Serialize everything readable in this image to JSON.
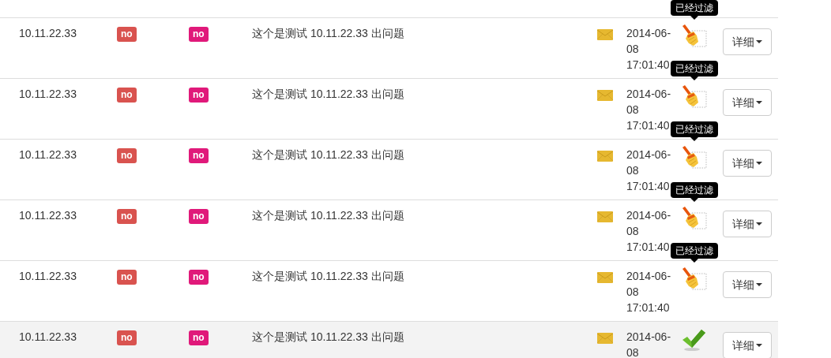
{
  "rows": [
    {
      "ip": "10.11.22.33",
      "flags": [
        {
          "text": "no",
          "color": "#d9534f"
        },
        {
          "text": "no",
          "color": "#e0197a"
        }
      ],
      "message": "这个是测试 10.11.22.33 出问题",
      "date": "2014-06-08 17:01:40",
      "status": {
        "kind": "filtered",
        "tooltip": "已经过滤"
      },
      "action": "详细",
      "selected": false
    },
    {
      "ip": "10.11.22.33",
      "flags": [
        {
          "text": "no",
          "color": "#d9534f"
        },
        {
          "text": "no",
          "color": "#e0197a"
        }
      ],
      "message": "这个是测试 10.11.22.33 出问题",
      "date": "2014-06-08 17:01:40",
      "status": {
        "kind": "filtered",
        "tooltip": "已经过滤"
      },
      "action": "详细",
      "selected": false
    },
    {
      "ip": "10.11.22.33",
      "flags": [
        {
          "text": "no",
          "color": "#d9534f"
        },
        {
          "text": "no",
          "color": "#e0197a"
        }
      ],
      "message": "这个是测试 10.11.22.33 出问题",
      "date": "2014-06-08 17:01:40",
      "status": {
        "kind": "filtered",
        "tooltip": "已经过滤"
      },
      "action": "详细",
      "selected": false
    },
    {
      "ip": "10.11.22.33",
      "flags": [
        {
          "text": "no",
          "color": "#d9534f"
        },
        {
          "text": "no",
          "color": "#e0197a"
        }
      ],
      "message": "这个是测试 10.11.22.33 出问题",
      "date": "2014-06-08 17:01:40",
      "status": {
        "kind": "filtered",
        "tooltip": "已经过滤"
      },
      "action": "详细",
      "selected": false
    },
    {
      "ip": "10.11.22.33",
      "flags": [
        {
          "text": "no",
          "color": "#d9534f"
        },
        {
          "text": "no",
          "color": "#e0197a"
        }
      ],
      "message": "这个是测试 10.11.22.33 出问题",
      "date": "2014-06-08 17:01:40",
      "status": {
        "kind": "filtered",
        "tooltip": "已经过滤"
      },
      "action": "详细",
      "selected": false
    },
    {
      "ip": "10.11.22.33",
      "flags": [
        {
          "text": "no",
          "color": "#d9534f"
        },
        {
          "text": "no",
          "color": "#e0197a"
        }
      ],
      "message": "这个是测试 10.11.22.33 出问题",
      "date": "2014-06-08",
      "status": {
        "kind": "passed"
      },
      "action": "详细",
      "selected": true
    }
  ]
}
